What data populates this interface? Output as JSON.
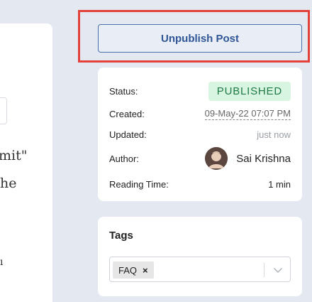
{
  "editor": {
    "line1": "mit\"",
    "line2": "he",
    "line3": "ı"
  },
  "actions": {
    "unpublish_label": "Unpublish Post"
  },
  "meta": {
    "status_label": "Status:",
    "status_value": "PUBLISHED",
    "created_label": "Created:",
    "created_value": "09-May-22 07:07 PM",
    "updated_label": "Updated:",
    "updated_value": "just now",
    "author_label": "Author:",
    "author_value": "Sai Krishna",
    "reading_label": "Reading Time:",
    "reading_value": "1 min"
  },
  "tags": {
    "title": "Tags",
    "selected": [
      "FAQ"
    ],
    "remove_glyph": "×"
  },
  "colors": {
    "accent": "#2f5597",
    "highlight": "#e4413a",
    "status_bg": "#d7f5e1",
    "status_fg": "#1f7a45"
  }
}
